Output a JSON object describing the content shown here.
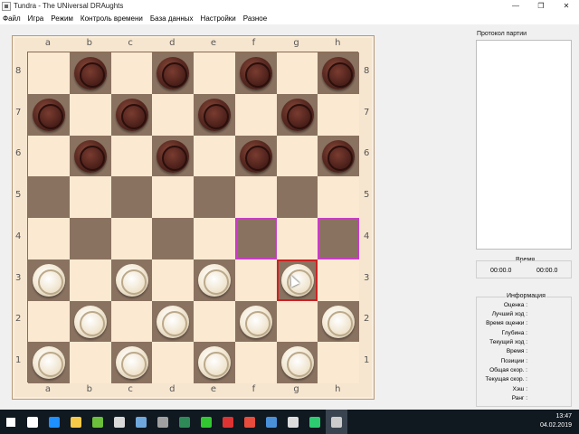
{
  "window": {
    "title": "Tundra - The UNiversal DRAughts",
    "minimize": "—",
    "maximize": "❐",
    "close": "✕"
  },
  "menu": [
    "Файл",
    "Игра",
    "Режим",
    "Контроль времени",
    "База данных",
    "Настройки",
    "Разное"
  ],
  "board": {
    "files": [
      "a",
      "b",
      "c",
      "d",
      "e",
      "f",
      "g",
      "h"
    ],
    "ranks": [
      "8",
      "7",
      "6",
      "5",
      "4",
      "3",
      "2",
      "1"
    ],
    "black_pieces": [
      "b8",
      "d8",
      "f8",
      "h8",
      "a7",
      "c7",
      "e7",
      "g7",
      "b6",
      "d6",
      "f6",
      "h6"
    ],
    "white_pieces": [
      "a3",
      "c3",
      "e3",
      "g3",
      "b2",
      "d2",
      "f2",
      "h2",
      "a1",
      "c1",
      "e1",
      "g1"
    ],
    "selected_square": "g3",
    "target_squares": [
      "f4",
      "h4"
    ],
    "colors": {
      "light_square": "#fbe9d2",
      "dark_square": "#8a7260",
      "target_highlight": "#c83cc4",
      "selected_highlight": "#cc2222"
    }
  },
  "side_panel": {
    "protocol_label": "Протокол партии",
    "time_label": "Время",
    "time_left": "00:00.0",
    "time_right": "00:00.0",
    "info_label": "Информация",
    "info_rows": [
      "Оценка :",
      "Лучший ход :",
      "Время оценки :",
      "Глубина :",
      "Текущий ход :",
      "Время :",
      "Позиции :",
      "Общая скор. :",
      "Текущая скор. :",
      "Хэш :",
      "Ранг :"
    ]
  },
  "taskbar": {
    "icons": [
      "windows-start-icon",
      "task-view-icon",
      "edge-browser-icon",
      "store-icon",
      "minecraft-icon",
      "photos-icon",
      "media-player-icon",
      "calculator-icon",
      "spreadsheet-icon",
      "mail-agent-icon",
      "yandex-icon",
      "yandex-browser-icon",
      "chrome-icon",
      "mail-icon",
      "game-icon",
      "tundra-app-icon"
    ],
    "time": "13:47",
    "date": "04.02.2019"
  }
}
